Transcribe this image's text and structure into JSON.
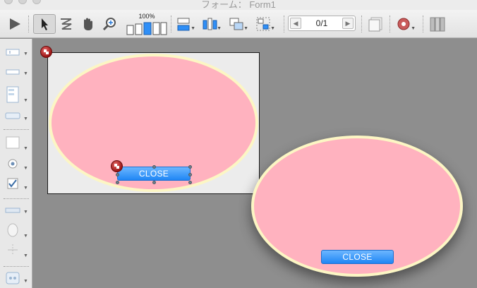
{
  "window": {
    "title": "フォーム： Form1"
  },
  "toolbar": {
    "zoom_label": "100%",
    "page_indicator": "0/1",
    "icons": [
      "run-icon",
      "arrow-tool-icon",
      "tab-order-icon",
      "hand-tool-icon",
      "zoom-tool-icon",
      "zoom-levels-icon",
      "align-icon",
      "distribute-icon",
      "layer-icon",
      "group-icon",
      "previous-page-icon",
      "next-page-icon",
      "page-view-icon",
      "settings-icon",
      "library-icon"
    ]
  },
  "palette": {
    "items": [
      "text-field-tool",
      "input-tool",
      "list-tool",
      "button-tool",
      "rectangle-tool",
      "radio-tool",
      "checkbox-tool",
      "ruler-tool",
      "oval-tool",
      "splitter-tool",
      "plugin-tool"
    ]
  },
  "design": {
    "close_button_label": "CLOSE"
  },
  "preview": {
    "close_button_label": "CLOSE"
  },
  "colors": {
    "oval_fill": "#ffb2bf",
    "oval_border": "#fcf6c4",
    "button": "#2f8ff7",
    "canvas": "#8e8e8e"
  }
}
